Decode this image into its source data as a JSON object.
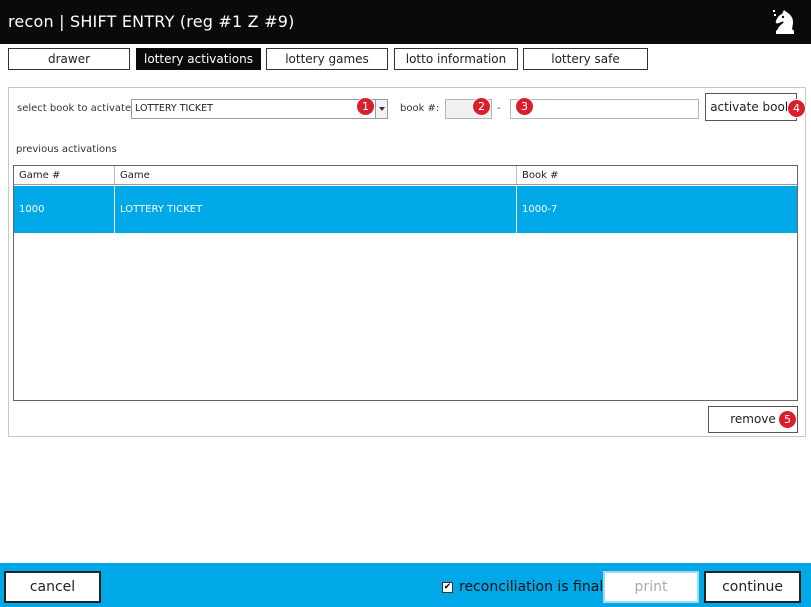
{
  "window": {
    "title": "recon | SHIFT ENTRY  (reg #1  Z #9)",
    "logo_icon": "chess-knight-icon"
  },
  "tabs": [
    {
      "label": "drawer",
      "active": false
    },
    {
      "label": "lottery activations",
      "active": true
    },
    {
      "label": "lottery games",
      "active": false
    },
    {
      "label": "lotto information",
      "active": false
    },
    {
      "label": "lottery safe",
      "active": false
    }
  ],
  "activation": {
    "select_label": "select book to activate",
    "selected_book": "LOTTERY TICKET",
    "book_label": "book #:",
    "book_prefix": "",
    "dash": "-",
    "book_number": "",
    "activate_label": "activate book",
    "previous_label": "previous activations",
    "remove_label": "remove"
  },
  "markers": [
    "1",
    "2",
    "3",
    "4",
    "5"
  ],
  "table": {
    "columns": [
      "Game #",
      "Game",
      "Book #"
    ],
    "rows": [
      {
        "game_no": "1000",
        "game": "LOTTERY TICKET",
        "book_no": "1000-7",
        "selected": true
      }
    ]
  },
  "footer": {
    "cancel_label": "cancel",
    "final_label": "reconciliation is final",
    "final_checked": true,
    "print_label": "print",
    "continue_label": "continue"
  },
  "colors": {
    "accent": "#00a8e8",
    "titlebar": "#0a0a0a",
    "marker": "#d91f2d"
  }
}
